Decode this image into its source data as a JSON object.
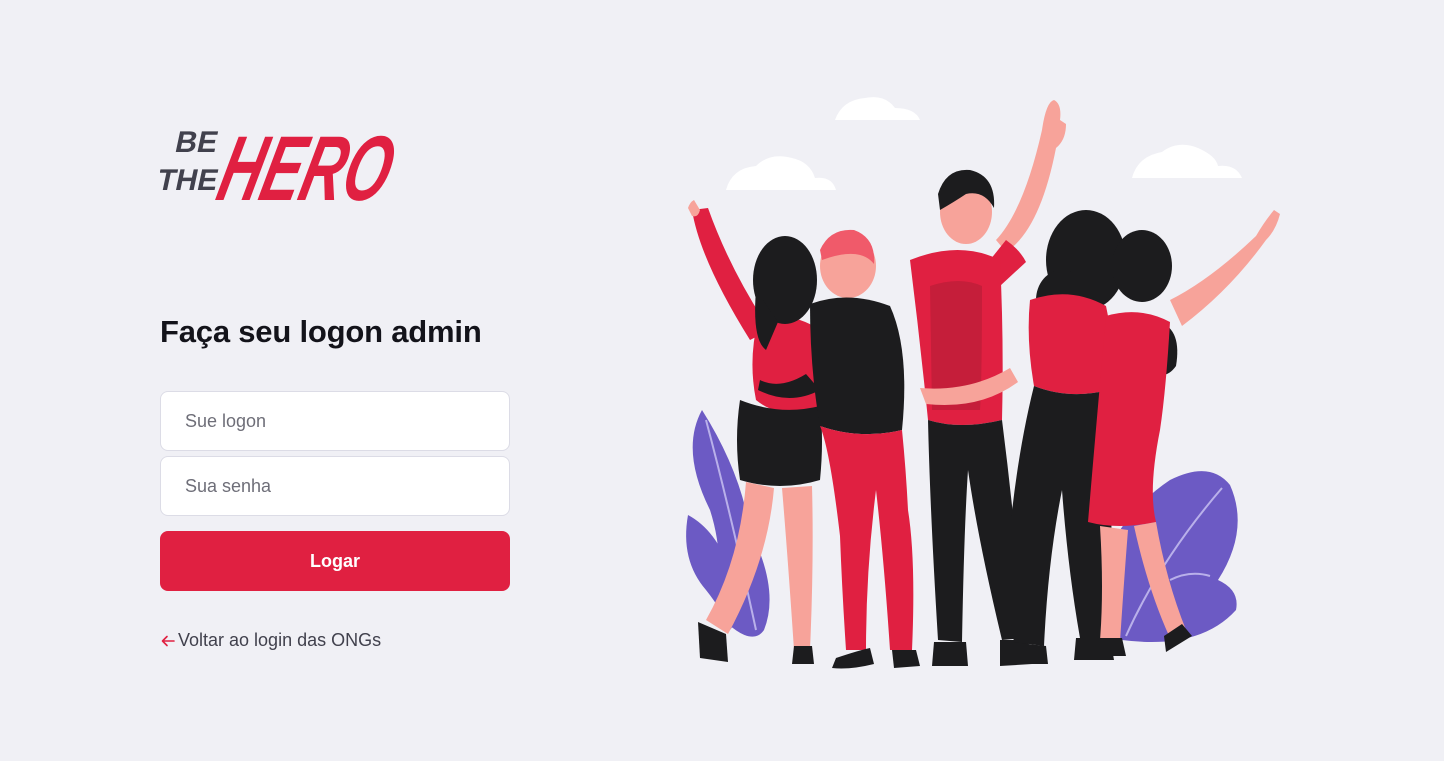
{
  "logo": {
    "word_be": "BE",
    "word_the": "THE",
    "word_hero": "HERO"
  },
  "heading": "Faça seu logon admin",
  "form": {
    "logon_placeholder": "Sue logon",
    "senha_placeholder": "Sua senha",
    "submit_label": "Logar"
  },
  "back_link": {
    "label": "Voltar ao login das ONGs",
    "icon": "arrow-left-icon"
  },
  "colors": {
    "brand": "#e02041",
    "background": "#f0f0f5",
    "text": "#13131a",
    "accent_purple": "#6c5ac4"
  }
}
